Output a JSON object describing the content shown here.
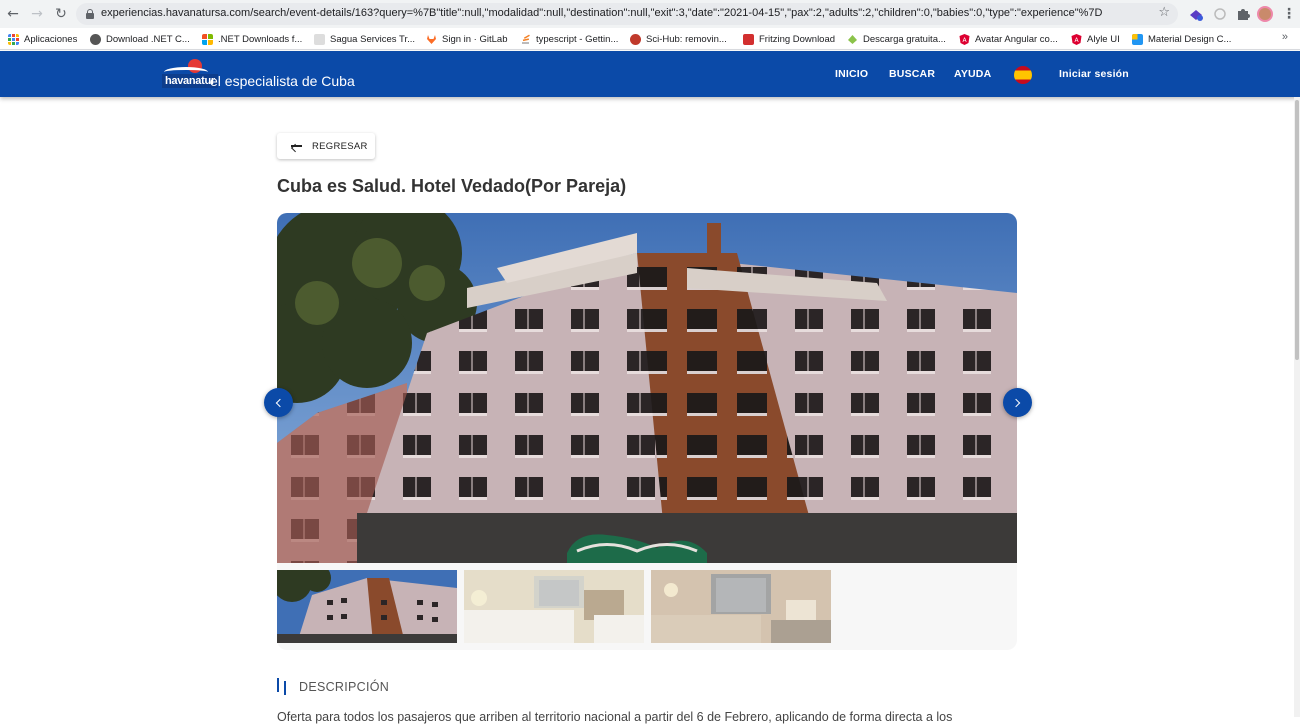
{
  "browser": {
    "url": "experiencias.havanatursa.com/search/event-details/163?query=%7B\"title\":null,\"modalidad\":null,\"destination\":null,\"exit\":3,\"date\":\"2021-04-15\",\"pax\":2,\"adults\":2,\"children\":0,\"babies\":0,\"type\":\"experience\"%7D",
    "back_icon": "arrow-left-icon",
    "forward_icon": "arrow-right-icon",
    "reload_icon": "reload-icon",
    "star_icon": "star-icon",
    "bookmarks": [
      {
        "label": "Aplicaciones",
        "icon": "apps-grid-icon",
        "color": "#4285f4"
      },
      {
        "label": "Download .NET C...",
        "icon": "globe-icon",
        "color": "#555555"
      },
      {
        "label": ".NET Downloads f...",
        "icon": "windows-icon",
        "color": "#00a4ef"
      },
      {
        "label": "Sagua Services Tr...",
        "icon": "sagua-icon",
        "color": "#999999"
      },
      {
        "label": "Sign in · GitLab",
        "icon": "gitlab-icon",
        "color": "#fc6d26"
      },
      {
        "label": "typescript - Gettin...",
        "icon": "stackoverflow-icon",
        "color": "#f48024"
      },
      {
        "label": "Sci-Hub: removin...",
        "icon": "scihub-icon",
        "color": "#c0392b"
      },
      {
        "label": "Fritzing Download",
        "icon": "fritzing-icon",
        "color": "#d22f2f"
      },
      {
        "label": "Descarga gratuita...",
        "icon": "android-icon",
        "color": "#8bc34a"
      },
      {
        "label": "Avatar Angular co...",
        "icon": "angular-icon",
        "color": "#dd0031"
      },
      {
        "label": "Alyle UI",
        "icon": "angular-icon",
        "color": "#dd0031"
      },
      {
        "label": "Material Design C...",
        "icon": "material-icon",
        "color": "#2196f3"
      }
    ],
    "bookmarks_more": "»"
  },
  "site": {
    "logo_word": "havanatur",
    "tagline": "el especialista de Cuba",
    "nav": [
      "INICIO",
      "BUSCAR",
      "AYUDA"
    ],
    "flag_icon": "spain-flag-icon",
    "login": "Iniciar sesión",
    "brand_color": "#0b4aa8"
  },
  "page": {
    "back_label": "REGRESAR",
    "title": "Cuba es Salud. Hotel Vedado(Por Pareja)",
    "gallery": {
      "main_image": "hotel-building-facade",
      "thumbnails": [
        "hotel-building-facade",
        "hotel-room-twin-beds",
        "hotel-room-double-bed"
      ],
      "prev_icon": "chevron-left-icon",
      "next_icon": "chevron-right-icon"
    },
    "section_label": "DESCRIPCIÓN",
    "description": "Oferta para todos los pasajeros que arriben al territorio nacional a partir del 6 de Febrero, aplicando de forma directa a los"
  }
}
